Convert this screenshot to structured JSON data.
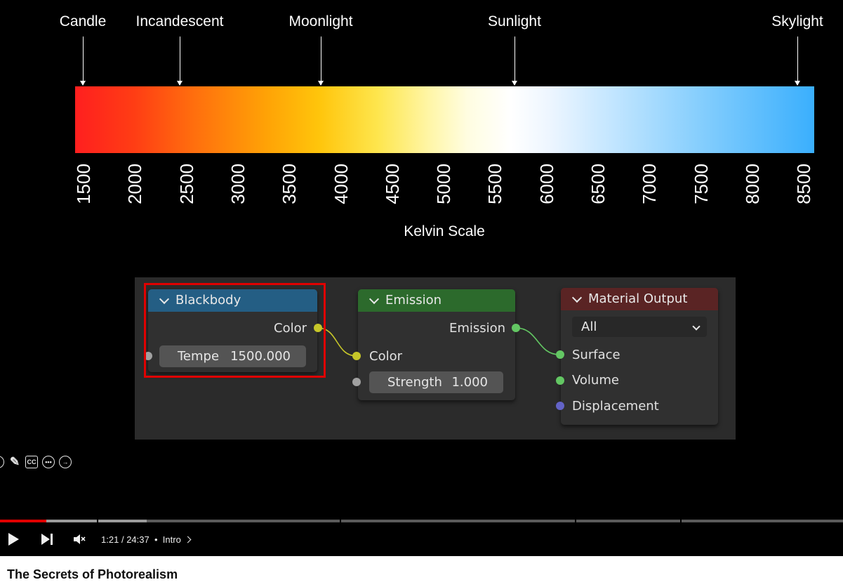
{
  "kelvin_chart": {
    "sources": [
      "Candle",
      "Incandescent",
      "Moonlight",
      "Sunlight",
      "Skylight"
    ],
    "ticks": [
      "1500",
      "2000",
      "2500",
      "3000",
      "3500",
      "4000",
      "4500",
      "5000",
      "5500",
      "6000",
      "6500",
      "7000",
      "7500",
      "8000",
      "8500"
    ],
    "title": "Kelvin Scale"
  },
  "nodes": {
    "blackbody": {
      "title": "Blackbody",
      "output_label": "Color",
      "field_label": "Tempe",
      "field_value": "1500.000",
      "header_color": "#245e84"
    },
    "emission": {
      "title": "Emission",
      "output_label": "Emission",
      "color_label": "Color",
      "strength_label": "Strength",
      "strength_value": "1.000",
      "header_color": "#2c6a2c"
    },
    "material_output": {
      "title": "Material Output",
      "target": "All",
      "surface_label": "Surface",
      "volume_label": "Volume",
      "displacement_label": "Displacement",
      "header_color": "#5a2424"
    }
  },
  "overlay_icons": [
    "circle-icon",
    "pencil-icon",
    "cc-icon",
    "more-icon",
    "forward-icon"
  ],
  "player": {
    "time_current": "1:21",
    "time_separator": "/",
    "time_total": "24:37",
    "dot": "•",
    "chapter": "Intro",
    "progress_fraction": 0.055,
    "played_color": "#e00000"
  },
  "video_title": "The Secrets of Photorealism"
}
